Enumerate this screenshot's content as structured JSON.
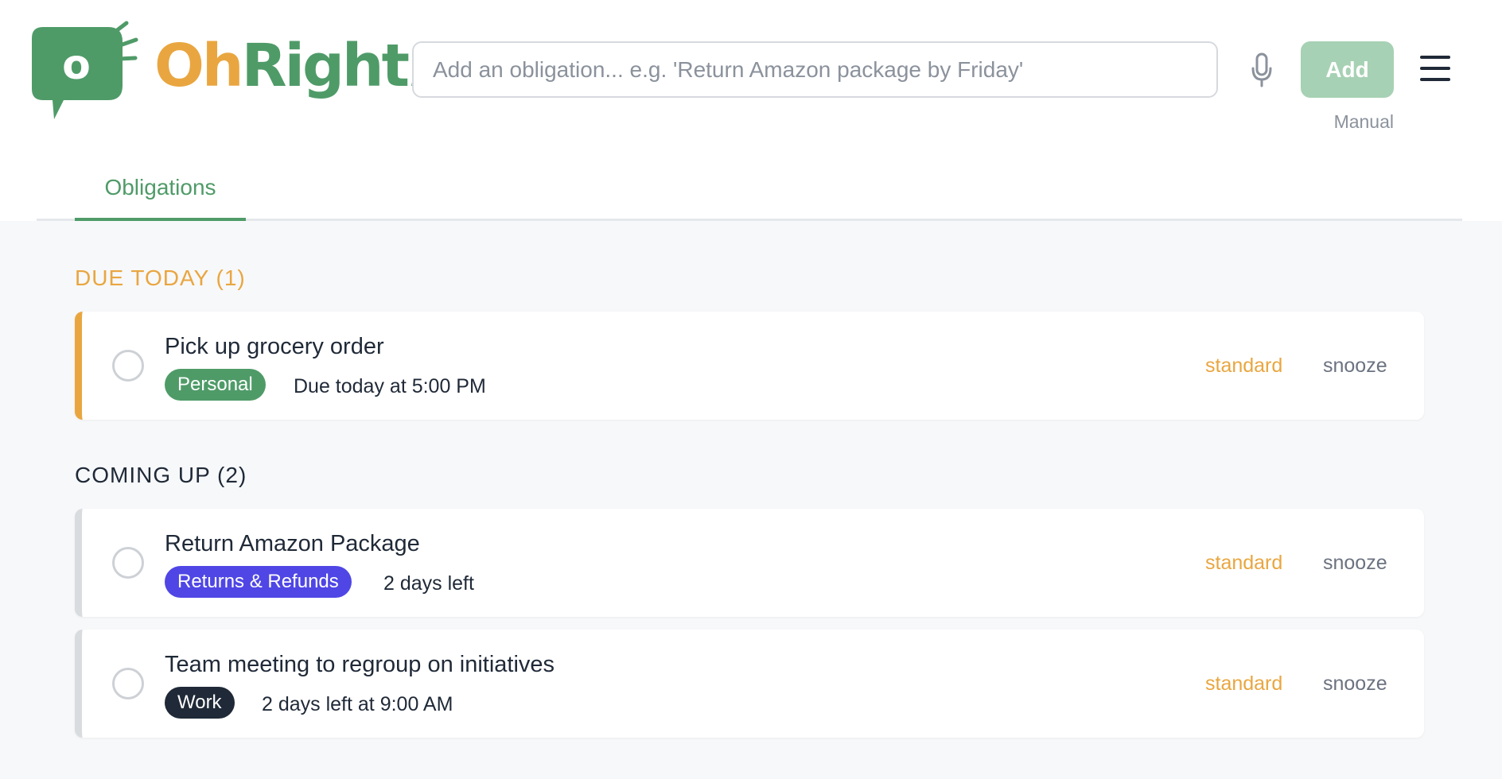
{
  "app": {
    "logo_oh": "Oh",
    "logo_right": "Right",
    "logo_bang": "!",
    "logo_bubble_letter": "o",
    "brand_green": "#4f9b68",
    "brand_orange": "#e9a640"
  },
  "header": {
    "input_placeholder": "Add an obligation... e.g. 'Return Amazon package by Friday'",
    "input_value": "",
    "mic_icon": "microphone-icon",
    "add_label": "Add",
    "mode_label": "Manual",
    "menu_icon": "hamburger-menu-icon"
  },
  "tabs": [
    {
      "label": "Obligations",
      "active": true
    }
  ],
  "sections": {
    "today": {
      "title": "DUE TODAY (1)",
      "color": "#e9a640",
      "items": [
        {
          "title": "Pick up grocery order",
          "tag": "Personal",
          "tag_color": "#4f9b68",
          "due": "Due today at 5:00 PM",
          "priority": "standard",
          "snooze": "snooze",
          "done": false
        }
      ]
    },
    "upcoming": {
      "title": "COMING UP (2)",
      "items": [
        {
          "title": "Return Amazon Package",
          "tag": "Returns & Refunds",
          "tag_color": "#4f46e5",
          "due": "2 days left",
          "priority": "standard",
          "snooze": "snooze",
          "done": false
        },
        {
          "title": "Team meeting to regroup on initiatives",
          "tag": "Work",
          "tag_color": "#1f2937",
          "due": "2 days left at 9:00 AM",
          "priority": "standard",
          "snooze": "snooze",
          "done": false
        }
      ]
    }
  }
}
